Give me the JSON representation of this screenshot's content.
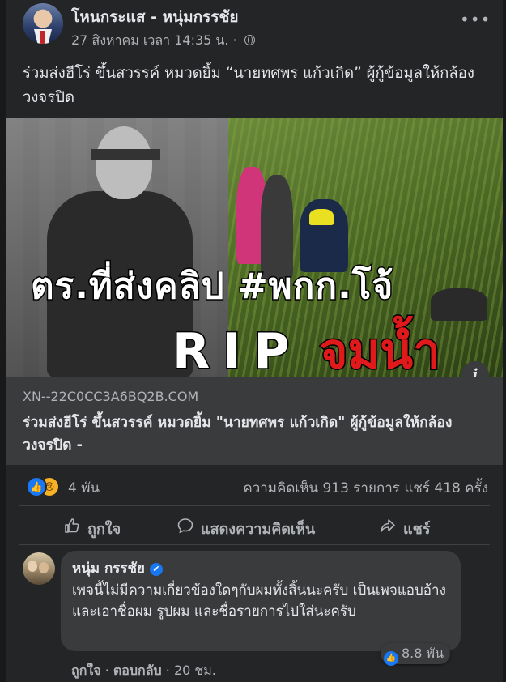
{
  "post": {
    "author": "โหนกระแส - หนุ่มกรรชัย",
    "timestamp": "27 สิงหาคม เวลา 14:35 น. ·",
    "privacy_icon": "globe-icon",
    "more_icon": "more-options-icon",
    "more_label": "•••",
    "caption": "ร่วมส่งฮีโร่ ขึ้นสวรรค์ หมวดยิ้ม “นายทศพร แก้วเกิด” ผู้กู้ข้อมูลให้กล้องวงจรปิด",
    "image": {
      "overlay_line1": "ตร.ที่ส่งคลิป #พกก.โจ้",
      "overlay_rip": "RIP",
      "overlay_red": "จมน้ำ",
      "info_label": "i"
    },
    "link": {
      "domain": "XN--22C0CC3A6BQ2B.COM",
      "title": "ร่วมส่งฮีโร่ ขึ้นสวรรค์ หมวดยิ้ม \"นายทศพร แก้วเกิด\" ผู้กู้ข้อมูลให้กล้องวงจรปิด -"
    },
    "stats": {
      "reaction_count": "4 พัน",
      "comments_shares": "ความคิดเห็น 913 รายการ แชร์ 418 ครั้ง",
      "like_glyph": "👍",
      "sad_glyph": "😢"
    },
    "actions": {
      "like": "ถูกใจ",
      "comment": "แสดงความคิดเห็น",
      "share": "แชร์"
    },
    "comment": {
      "author": "หนุ่ม กรรชัย",
      "verified_glyph": "✔",
      "text": "เพจนี้ไม่มีความเกี่ยวข้องใดๆกับผมทั้งสิ้นนะครับ เป็นเพจแอบอ้าง และเอาชื่อผม รูปผม และชื่อรายการไปใส่นะครับ",
      "reaction_count": "8.8 พัน",
      "like": "ถูกใจ",
      "reply": "ตอบกลับ",
      "time": "20 ชม.",
      "sep": "·"
    }
  },
  "colors": {
    "background": "#18191a",
    "card": "#242526",
    "surface": "#3a3b3c",
    "text_primary": "#e4e6eb",
    "text_secondary": "#b0b3b8",
    "facebook_blue": "#1877f2",
    "overlay_red": "#e01a1a"
  }
}
